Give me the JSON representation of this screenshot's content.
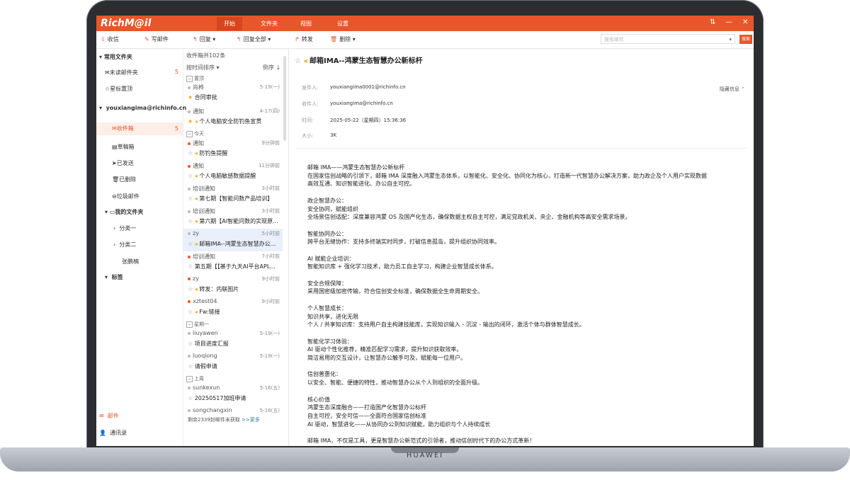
{
  "device": {
    "brand": "HUAWEI"
  },
  "app": {
    "logo": "RichM@il"
  },
  "menu": {
    "tabs": [
      "开始",
      "文件夹",
      "视图",
      "设置"
    ],
    "active": "开始",
    "window_controls": [
      "⇅",
      "—",
      "✕"
    ]
  },
  "toolbar": {
    "receive": "收信",
    "compose": "写邮件",
    "reply": "回复",
    "reply_all": "回复全部",
    "forward": "转发",
    "delete": "删除",
    "search_placeholder": "搜索邮件",
    "search_button": "搜索"
  },
  "sidebar": {
    "common_folders": "常用文件夹",
    "unread": "未读邮件夹",
    "unread_count": "5",
    "starred": "星标置顶",
    "account": "youxiangima@richinfo.cn",
    "inbox": "收件箱",
    "inbox_count": "5",
    "drafts": "草稿箱",
    "sent": "已发送",
    "deleted": "已删除",
    "junk": "垃圾邮件",
    "my_folders": "我的文件夹",
    "cat1": "分类一",
    "cat2": "分类二",
    "zhang": "张鹏楠",
    "tags": "标签",
    "mail_nav": "邮件",
    "contacts_nav": "通讯录"
  },
  "list": {
    "count_label": "收件箱共102条",
    "sort_label": "按时间排序",
    "order_label": "倒序",
    "sections": {
      "pinned": "置顶",
      "today": "今天",
      "monday": "星期一",
      "last": "上周"
    },
    "items": [
      {
        "from": "肖桦",
        "time": "5-19(一)",
        "subject": "合同审批",
        "dot": "#bbb"
      },
      {
        "from": "通知",
        "time": "4-17(四)",
        "subject": "个人电脑安全防钓鱼宣贯",
        "dot": "#bbb"
      },
      {
        "from": "通知",
        "time": "9分钟前",
        "subject": "防钓鱼提醒",
        "dot": "#e8562a"
      },
      {
        "from": "通知",
        "time": "11分钟前",
        "subject": "个人电脑敏感数据提醒",
        "dot": "#e8562a"
      },
      {
        "from": "培训通知",
        "time": "3小时前",
        "subject": "第七期【智能问数产品培训】",
        "dot": "#bbb"
      },
      {
        "from": "培训通知",
        "time": "3小时前",
        "subject": "第六期【AI智能问数的实现原...",
        "dot": "#bbb"
      },
      {
        "from": "zy",
        "time": "5小时前",
        "subject": "邮箱IMA--鸿蒙生态智慧办公...",
        "dot": "#bbb"
      },
      {
        "from": "培训通知",
        "time": "7小时前",
        "subject": "第五期【【基于九天AI平台APL...",
        "dot": "#e8562a"
      },
      {
        "from": "zy",
        "time": "9小时前",
        "subject": "转发：内联图片",
        "dot": "#e8562a"
      },
      {
        "from": "xztest04",
        "time": "9小时前",
        "subject": "Fw:链接",
        "dot": "#e8562a"
      },
      {
        "from": "liuyawen",
        "time": "5-19(一)",
        "subject": "项目进度汇报",
        "dot": "#bbb"
      },
      {
        "from": "luoqiong",
        "time": "5-19(一)",
        "subject": "请假申请",
        "dot": "#bbb"
      },
      {
        "from": "sunkexun",
        "time": "5-16(五)",
        "subject": "20250517加班申请",
        "dot": "#bbb"
      },
      {
        "from": "songchangxin",
        "time": "5-16(五)",
        "subject": "",
        "dot": "#bbb"
      }
    ],
    "footer": "剩余2339封邮件未获取 ",
    "footer_more": ">>更多"
  },
  "reader": {
    "subject": "邮箱IMA--鸿蒙生态智慧办公新标杆",
    "hide_info": "隐藏信息",
    "from_label": "发件人:",
    "from": "youxiangima0001@richinfo.cn",
    "to_label": "收件人:",
    "to": "youxiangima@richinfo.cn",
    "time_label": "时间:",
    "time": "2025-05-22（星期四）15:36:36",
    "size_label": "大小:",
    "size": "3K",
    "body": [
      "邮箱 IMA——鸿蒙生态智慧办公新标杆",
      "在国家信创战略的引领下，邮箱 IMA 深度融入鸿蒙生态体系，以智能化、安全化、协同化为核心，打造新一代智慧办公解决方案，助力政企及个人用户实现数据",
      "高效互通、知识智能进化、办公自主可控。",
      "",
      "政企智慧办公：",
      "安全协同，赋能组织",
      "全场景信创适配：深度兼容鸿蒙 OS 及国产化生态，确保数据主权自主可控，满足党政机关、央企、金融机构等高安全需求场景。",
      "",
      "智能协同办公：",
      "跨平台无缝协作：支持多终端实时同步，打破信息孤岛，提升组织协同效率。",
      "",
      "AI 赋能企业培训：",
      "智能知识库 + 强化学习技术，助力员工自主学习，构建企业智慧成长体系。",
      "",
      "安全合规保障：",
      "采用国密级加密传输，符合信创安全标准，确保数据全生命周期安全。",
      "",
      "个人智慧成长：",
      "知识共享，进化无限",
      "个人 / 共享知识库：支持用户自主构建技能库，实现知识输入 - 沉淀 - 输出的闭环，激活个体与群体智慧成长。",
      "",
      "智能化学习体验：",
      "AI 驱动个性化推荐，精准匹配学习需求，提升知识获取效率。",
      "简洁易用的交互设计，让智慧办公触手可及，赋能每一位用户。",
      "",
      "信创普惠化：",
      "以安全、智能、便捷的特性，推动智慧办公从个人到组织的全面升级。",
      "",
      "核心价值",
      "鸿蒙生态深度融合——打造国产化智慧办公标杆",
      "自主可控，安全可信——全面符合国家信创标准",
      "AI 驱动，智慧进化——从协同办公到知识赋能，助力组织与个人持续成长",
      "",
      "邮箱 IMA，不仅是工具，更是智慧办公新范式的引领者，推动信创时代下的办公方式革新！"
    ]
  },
  "colors": {
    "accent": "#e8562a",
    "selected_row": "#e9f0fb",
    "flag": "#f5a623"
  }
}
